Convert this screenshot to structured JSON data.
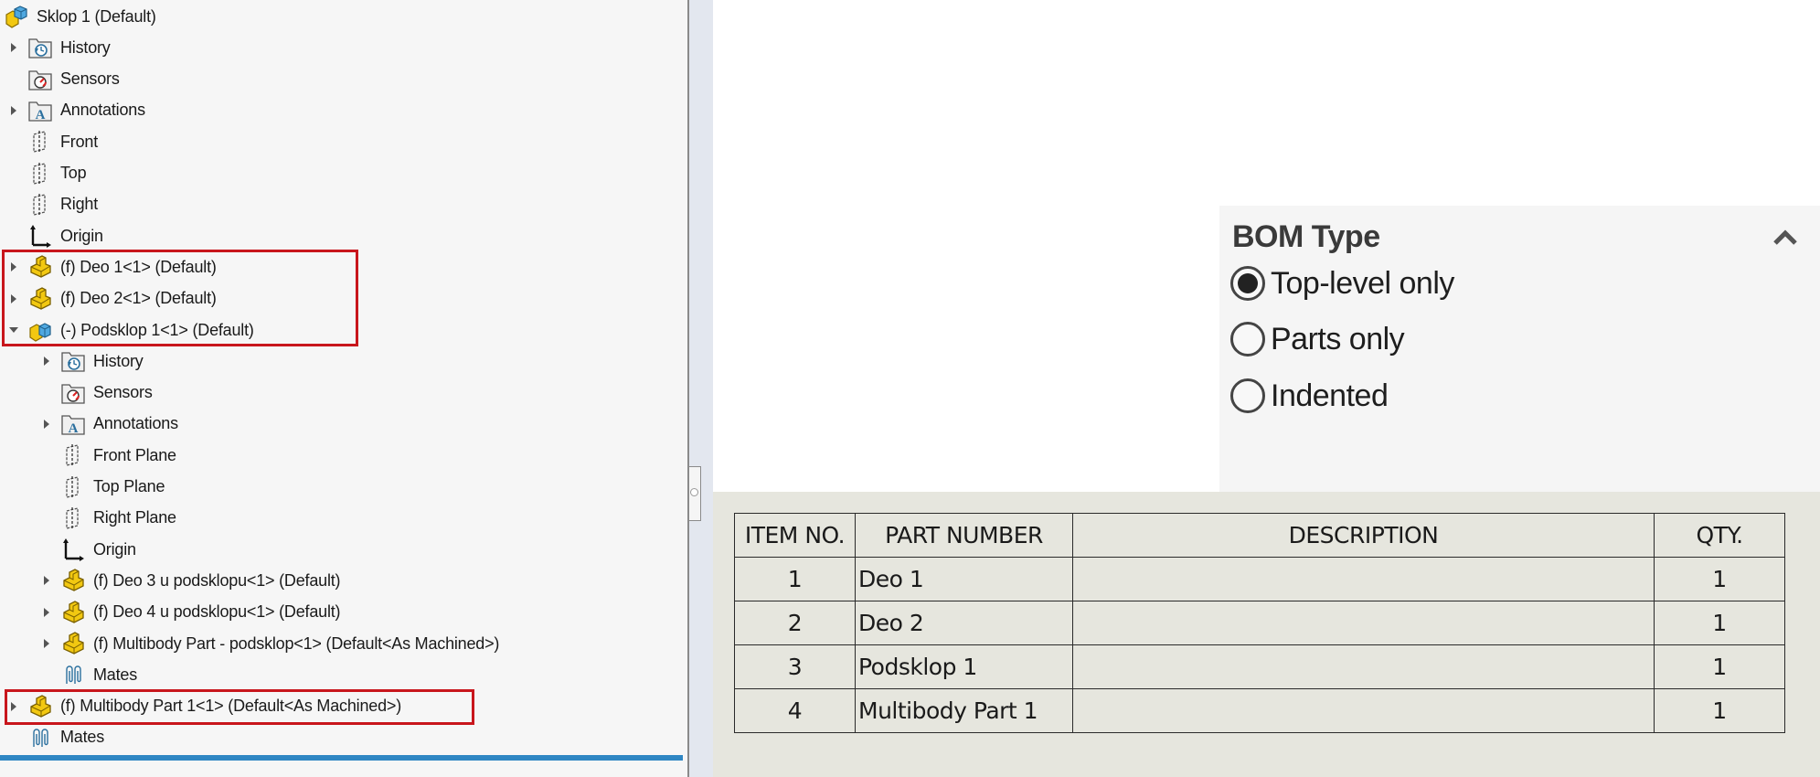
{
  "feature_tree": {
    "items": [
      {
        "label": "Sklop 1  (Default)",
        "icon": "assembly-icon",
        "level": 0,
        "expander": "none"
      },
      {
        "label": "History",
        "icon": "history-folder-icon",
        "level": 1,
        "expander": "collapsed"
      },
      {
        "label": "Sensors",
        "icon": "sensors-folder-icon",
        "level": 1,
        "expander": "none"
      },
      {
        "label": "Annotations",
        "icon": "annotations-folder-icon",
        "level": 1,
        "expander": "collapsed"
      },
      {
        "label": "Front",
        "icon": "plane-icon",
        "level": 1,
        "expander": "none"
      },
      {
        "label": "Top",
        "icon": "plane-icon",
        "level": 1,
        "expander": "none"
      },
      {
        "label": "Right",
        "icon": "plane-icon",
        "level": 1,
        "expander": "none"
      },
      {
        "label": "Origin",
        "icon": "origin-icon",
        "level": 1,
        "expander": "none"
      },
      {
        "label": "(f) Deo 1<1> (Default)",
        "icon": "part-icon",
        "level": 1,
        "expander": "collapsed"
      },
      {
        "label": "(f) Deo 2<1> (Default)",
        "icon": "part-icon",
        "level": 1,
        "expander": "collapsed"
      },
      {
        "label": "(-) Podsklop 1<1> (Default)",
        "icon": "subassembly-icon",
        "level": 1,
        "expander": "expanded"
      },
      {
        "label": "History",
        "icon": "history-folder-icon",
        "level": 2,
        "expander": "collapsed"
      },
      {
        "label": "Sensors",
        "icon": "sensors-folder-icon",
        "level": 2,
        "expander": "none"
      },
      {
        "label": "Annotations",
        "icon": "annotations-folder-icon",
        "level": 2,
        "expander": "collapsed"
      },
      {
        "label": "Front Plane",
        "icon": "plane-icon",
        "level": 2,
        "expander": "none"
      },
      {
        "label": "Top Plane",
        "icon": "plane-icon",
        "level": 2,
        "expander": "none"
      },
      {
        "label": "Right Plane",
        "icon": "plane-icon",
        "level": 2,
        "expander": "none"
      },
      {
        "label": "Origin",
        "icon": "origin-icon",
        "level": 2,
        "expander": "none"
      },
      {
        "label": "(f) Deo 3 u podsklopu<1> (Default)",
        "icon": "part-icon",
        "level": 2,
        "expander": "collapsed"
      },
      {
        "label": "(f) Deo 4 u podsklopu<1> (Default)",
        "icon": "part-icon",
        "level": 2,
        "expander": "collapsed"
      },
      {
        "label": "(f) Multibody Part - podsklop<1> (Default<As Machined>)",
        "icon": "part-icon",
        "level": 2,
        "expander": "collapsed"
      },
      {
        "label": "Mates",
        "icon": "mates-icon",
        "level": 2,
        "expander": "none"
      },
      {
        "label": "(f) Multibody Part 1<1> (Default<As Machined>)",
        "icon": "part-icon",
        "level": 1,
        "expander": "collapsed"
      },
      {
        "label": "Mates",
        "icon": "mates-icon",
        "level": 1,
        "expander": "none"
      }
    ],
    "highlight_color": "#c8161c",
    "accent_bar_color": "#2f86c3"
  },
  "bom_type_panel": {
    "title": "BOM Type",
    "collapse_icon": "chevron-up-icon",
    "options": [
      {
        "label": "Top-level only",
        "selected": true
      },
      {
        "label": "Parts only",
        "selected": false
      },
      {
        "label": "Indented",
        "selected": false
      }
    ]
  },
  "bom_table": {
    "headers": [
      "ITEM NO.",
      "PART NUMBER",
      "DESCRIPTION",
      "QTY."
    ],
    "rows": [
      [
        "1",
        "Deo 1",
        "",
        "1"
      ],
      [
        "2",
        "Deo 2",
        "",
        "1"
      ],
      [
        "3",
        "Podsklop 1",
        "",
        "1"
      ],
      [
        "4",
        "Multibody Part 1",
        "",
        "1"
      ]
    ]
  }
}
